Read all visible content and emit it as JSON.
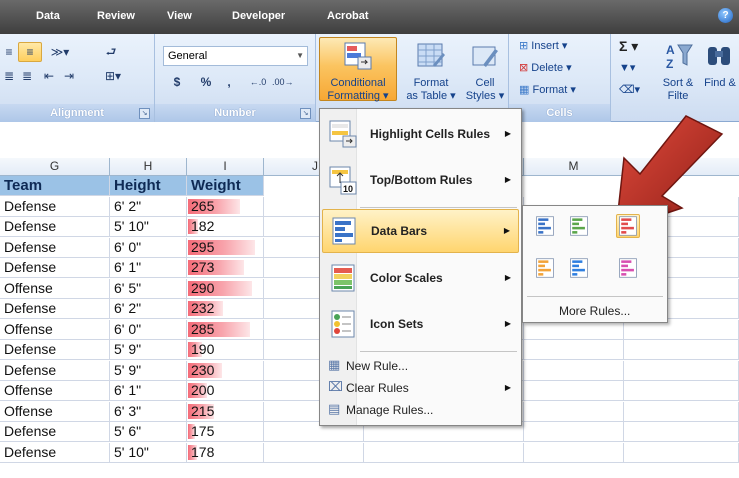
{
  "tabs": [
    "Data",
    "Review",
    "View",
    "Developer",
    "Acrobat"
  ],
  "help_icon": "help-icon",
  "ribbon": {
    "groups": {
      "alignment": "Alignment",
      "number": "Number",
      "cells": "Cells"
    },
    "number_format": "General",
    "number_buttons": [
      "$",
      "%",
      ","
    ],
    "conditional_formatting": [
      "Conditional",
      "Formatting ▾"
    ],
    "format_as_table": [
      "Format",
      "as Table ▾"
    ],
    "cell_styles": [
      "Cell",
      "Styles ▾"
    ],
    "insert": "Insert",
    "delete": "Delete",
    "format": "Format",
    "sort_filter": "Sort &",
    "sort_filter2": "Filte",
    "find_select": "Find &"
  },
  "columns": [
    "G",
    "H",
    "I",
    "J",
    "M"
  ],
  "table": {
    "headers": [
      "Team",
      "Height",
      "Weight"
    ],
    "rows": [
      {
        "team": "Defense",
        "height": "6' 2\"",
        "weight": "265",
        "bar": 0.72
      },
      {
        "team": "Defense",
        "height": "5' 10\"",
        "weight": "182",
        "bar": 0.07
      },
      {
        "team": "Defense",
        "height": "6' 0\"",
        "weight": "295",
        "bar": 0.95
      },
      {
        "team": "Defense",
        "height": "6' 1\"",
        "weight": "273",
        "bar": 0.78
      },
      {
        "team": "Offense",
        "height": "6' 5\"",
        "weight": "290",
        "bar": 0.91
      },
      {
        "team": "Defense",
        "height": "6' 2\"",
        "weight": "232",
        "bar": 0.46
      },
      {
        "team": "Offense",
        "height": "6' 0\"",
        "weight": "285",
        "bar": 0.87
      },
      {
        "team": "Defense",
        "height": "5' 9\"",
        "weight": "190",
        "bar": 0.13
      },
      {
        "team": "Defense",
        "height": "5' 9\"",
        "weight": "230",
        "bar": 0.44
      },
      {
        "team": "Offense",
        "height": "6' 1\"",
        "weight": "200",
        "bar": 0.2
      },
      {
        "team": "Offense",
        "height": "6' 3\"",
        "weight": "215",
        "bar": 0.32
      },
      {
        "team": "Defense",
        "height": "5' 6\"",
        "weight": "175",
        "bar": 0.02
      },
      {
        "team": "Defense",
        "height": "5' 10\"",
        "weight": "178",
        "bar": 0.04
      }
    ]
  },
  "menu": {
    "items": [
      {
        "label": "Highlight Cells Rules",
        "icon": "highlight-cells-icon"
      },
      {
        "label": "Top/Bottom Rules",
        "icon": "top-bottom-icon"
      },
      {
        "label": "Data Bars",
        "icon": "data-bars-icon"
      },
      {
        "label": "Color Scales",
        "icon": "color-scales-icon"
      },
      {
        "label": "Icon Sets",
        "icon": "icon-sets-icon"
      }
    ],
    "new_rule": "New Rule...",
    "clear_rules": "Clear Rules",
    "manage_rules": "Manage Rules..."
  },
  "submenu": {
    "bar_colors": [
      "#3a73c7",
      "#5aa64a",
      "#e24b4b",
      "#f2a33a",
      "#2f7fe0",
      "#d84fb0"
    ],
    "more_rules": "More Rules..."
  },
  "colors": {
    "arrow": "#c0372c",
    "header_fill": "#9bc2e6",
    "data_bar": "#f46b78"
  }
}
